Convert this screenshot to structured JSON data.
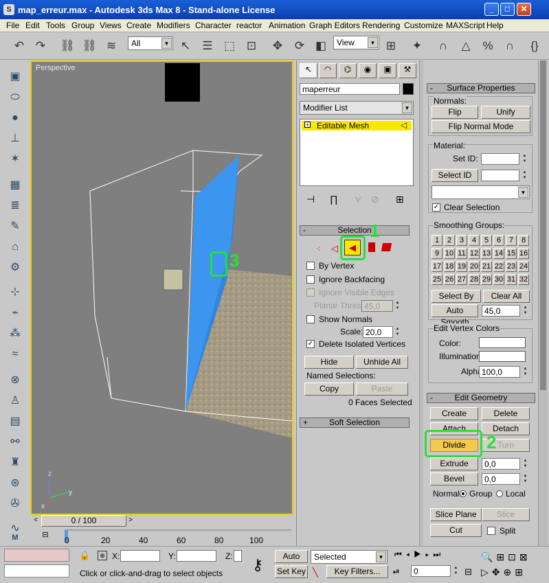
{
  "window": {
    "title": "map_erreur.max - Autodesk 3ds Max 8  - Stand-alone License"
  },
  "menu": [
    "File",
    "Edit",
    "Tools",
    "Group",
    "Views",
    "Create",
    "Modifiers",
    "Character",
    "reactor",
    "Animation",
    "Graph Editors",
    "Rendering",
    "Customize",
    "MAXScript",
    "Help"
  ],
  "toolbar": {
    "selection_filter": "All",
    "ref_coord": "View"
  },
  "viewport": {
    "label": "Perspective"
  },
  "timeslider": {
    "frame": "0 / 100"
  },
  "track_ticks": [
    "0",
    "20",
    "40",
    "60",
    "80",
    "100"
  ],
  "command_panel": {
    "object_name": "maperreur",
    "modifier_list": "Modifier List",
    "stack_item": "Editable Mesh",
    "selection": {
      "title": "Selection",
      "by_vertex": "By Vertex",
      "ignore_backfacing": "Ignore Backfacing",
      "ignore_visible_edges": "Ignore Visible Edges",
      "planar_thresh_label": "Planar Thresh:",
      "planar_thresh": "45,0",
      "show_normals": "Show Normals",
      "scale_label": "Scale:",
      "scale": "20,0",
      "delete_isolated": "Delete Isolated Vertices",
      "hide": "Hide",
      "unhide_all": "Unhide All",
      "named_selections": "Named Selections:",
      "copy": "Copy",
      "paste": "Paste",
      "status": "0 Faces Selected"
    },
    "soft_selection": "Soft Selection"
  },
  "surface": {
    "title": "Surface Properties",
    "normals": "Normals:",
    "flip": "Flip",
    "unify": "Unify",
    "flip_normal_mode": "Flip Normal Mode",
    "material": "Material:",
    "set_id": "Set ID:",
    "select_id": "Select ID",
    "clear_selection": "Clear Selection",
    "smoothing_groups": "Smoothing Groups:",
    "sg_numbers": [
      "1",
      "2",
      "3",
      "4",
      "5",
      "6",
      "7",
      "8",
      "9",
      "10",
      "11",
      "12",
      "13",
      "14",
      "15",
      "16",
      "17",
      "18",
      "19",
      "20",
      "21",
      "22",
      "23",
      "24",
      "25",
      "26",
      "27",
      "28",
      "29",
      "30",
      "31",
      "32"
    ],
    "select_by_sg": "Select By SG",
    "clear_all": "Clear All",
    "auto_smooth": "Auto Smooth",
    "auto_smooth_val": "45,0",
    "edit_vertex_colors": "Edit Vertex Colors",
    "color": "Color:",
    "illumination": "Illumination:",
    "alpha": "Alpha:",
    "alpha_val": "100,0"
  },
  "edit_geometry": {
    "title": "Edit Geometry",
    "create": "Create",
    "delete": "Delete",
    "attach": "Attach",
    "detach": "Detach",
    "divide": "Divide",
    "turn": "Turn",
    "extrude": "Extrude",
    "extrude_val": "0,0",
    "bevel": "Bevel",
    "bevel_val": "0,0",
    "normal": "Normal:",
    "group": "Group",
    "local": "Local",
    "slice_plane": "Slice Plane",
    "slice": "Slice",
    "cut": "Cut",
    "split": "Split"
  },
  "annotations": [
    "1",
    "2",
    "3"
  ],
  "status": {
    "x_label": "X:",
    "y_label": "Y:",
    "z_label": "Z:",
    "auto_key": "Auto Key",
    "selected": "Selected",
    "set_key": "Set Key",
    "key_filters": "Key Filters...",
    "frame": "0",
    "prompt": "Click or click-and-drag to select objects"
  },
  "colors": {
    "accent_green": "#29e038",
    "highlight_yellow": "#f8e800",
    "divide_button": "#f2c94c",
    "viewport_border": "#f0d000"
  }
}
